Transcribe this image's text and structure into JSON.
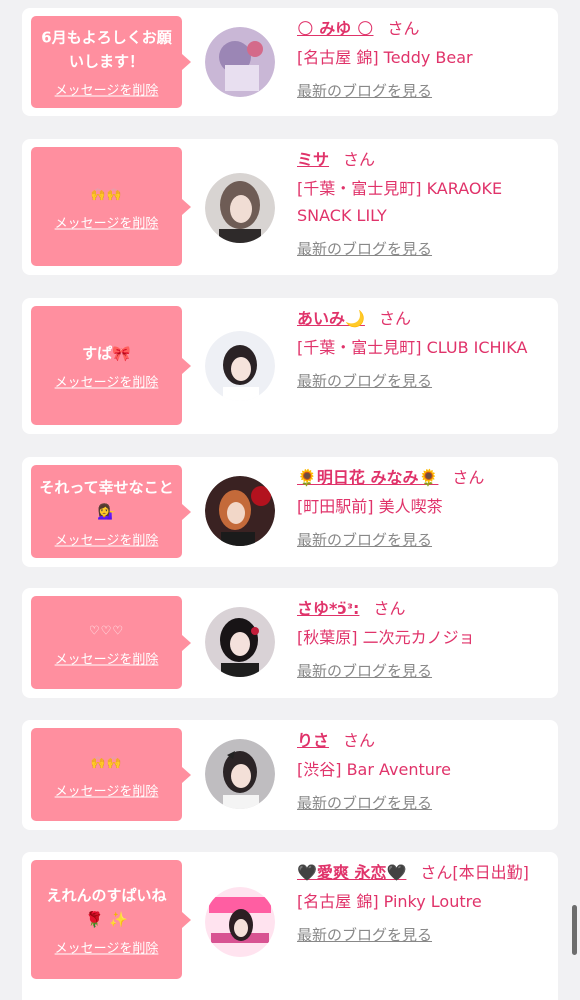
{
  "delete_label": "メッセージを削除",
  "blog_label": "最新のブログを見る",
  "san": "さん",
  "cards": [
    {
      "message": "6月もよろしくお願いします！",
      "name": "🌕 みゆ 🌕",
      "san": "さん",
      "shop": "[名古屋 錦] Teddy Bear"
    },
    {
      "message": "🙌🙌",
      "name": "ミサ",
      "san": "さん",
      "shop": "[千葉・富士見町] KARAOKE SNACK LILY"
    },
    {
      "message": "すぱ🎀",
      "name": "あいみ🌙",
      "san": "さん",
      "shop": "[千葉・富士見町] CLUB ICHIKA"
    },
    {
      "message": "それって幸せなこと💁‍♀️",
      "name": "🌻明日花 みなみ🌻",
      "san": "さん",
      "shop": "[町田駅前] 美人喫茶"
    },
    {
      "message": "♡♡♡",
      "name": "さゆ*ↄ̈ᵌ:",
      "san": "さん",
      "shop": "[秋葉原] 二次元カノジョ"
    },
    {
      "message": "🙌🙌",
      "name": "りさ",
      "san": "さん",
      "shop": "[渋谷] Bar Aventure"
    },
    {
      "message": "えれんのすぱいね 🌹 ✨",
      "name": "🖤愛爽 永恋🖤",
      "san": "さん[本日出勤]",
      "shop": "[名古屋 錦] Pinky Loutre"
    }
  ],
  "colors": {
    "accent": "#e0336a",
    "bubble": "#ff8f9f",
    "background": "#f1f1f3",
    "link_gray": "#888888"
  }
}
